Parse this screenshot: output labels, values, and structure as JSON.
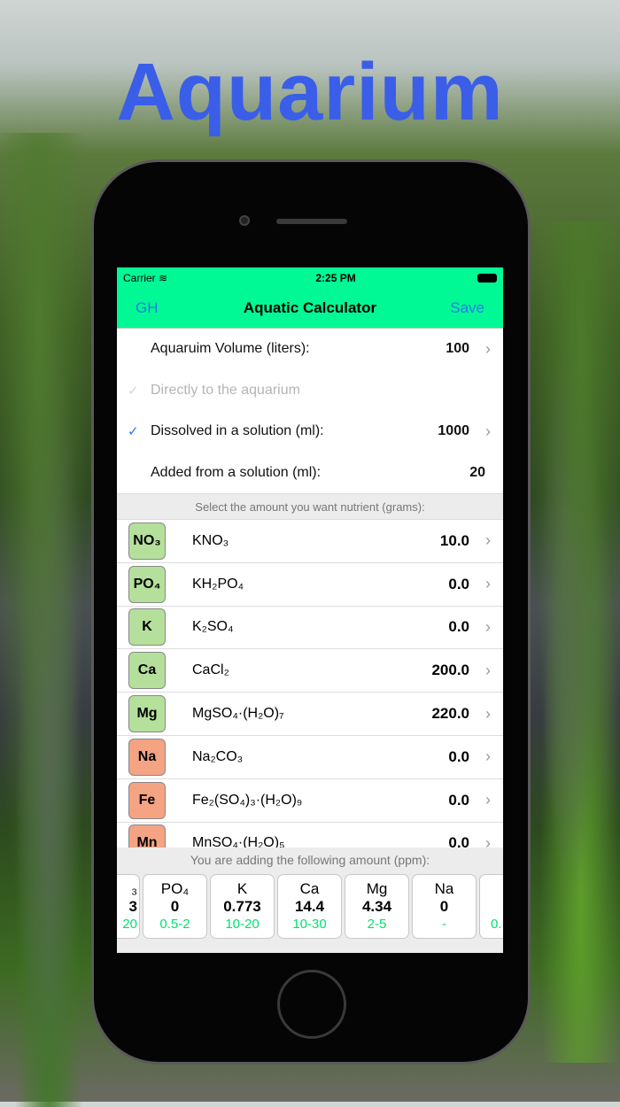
{
  "promo_title": "Aquarium",
  "status": {
    "carrier": "Carrier",
    "time": "2:25 PM"
  },
  "nav": {
    "left": "GH",
    "title": "Aquatic Calculator",
    "right": "Save"
  },
  "settings": [
    {
      "label": "Aquaruim Volume (liters):",
      "value": "100",
      "checked": false,
      "chevron": true
    },
    {
      "label": "Directly to the aquarium",
      "value": "",
      "checked": true,
      "disabled": true
    },
    {
      "label": "Dissolved in a solution (ml):",
      "value": "1000",
      "checked": true,
      "chevron": true
    },
    {
      "label": "Added from a solution (ml):",
      "value": "20",
      "checked": false
    }
  ],
  "section_header": "Select the amount you want nutrient (grams):",
  "nutrients": [
    {
      "badge": "NO₃",
      "compound": "KNO₃",
      "value": "10.0",
      "color": "#b4e09c"
    },
    {
      "badge": "PO₄",
      "compound": "KH₂PO₄",
      "value": "0.0",
      "color": "#b4e09c"
    },
    {
      "badge": "K",
      "compound": "K₂SO₄",
      "value": "0.0",
      "color": "#b4e09c"
    },
    {
      "badge": "Ca",
      "compound": "CaCl₂",
      "value": "200.0",
      "color": "#b4e09c"
    },
    {
      "badge": "Mg",
      "compound": "MgSO₄·(H₂O)₇",
      "value": "220.0",
      "color": "#b4e09c"
    },
    {
      "badge": "Na",
      "compound": "Na₂CO₃",
      "value": "0.0",
      "color": "#f4a383"
    },
    {
      "badge": "Fe",
      "compound": "Fe₂(SO₄)₃·(H₂O)₉",
      "value": "0.0",
      "color": "#f4a383"
    },
    {
      "badge": "Mn",
      "compound": "MnSO₄·(H₂O)₅",
      "value": "0.0",
      "color": "#f4a383"
    }
  ],
  "footer_header": "You are adding the following amount (ppm):",
  "ppm_cards": [
    {
      "name": "₃",
      "value": "3",
      "range": "20"
    },
    {
      "name": "PO₄",
      "value": "0",
      "range": "0.5-2"
    },
    {
      "name": "K",
      "value": "0.773",
      "range": "10-20"
    },
    {
      "name": "Ca",
      "value": "14.4",
      "range": "10-30"
    },
    {
      "name": "Mg",
      "value": "4.34",
      "range": "2-5"
    },
    {
      "name": "Na",
      "value": "0",
      "range": "-"
    },
    {
      "name": "",
      "value": "",
      "range": "0."
    }
  ]
}
